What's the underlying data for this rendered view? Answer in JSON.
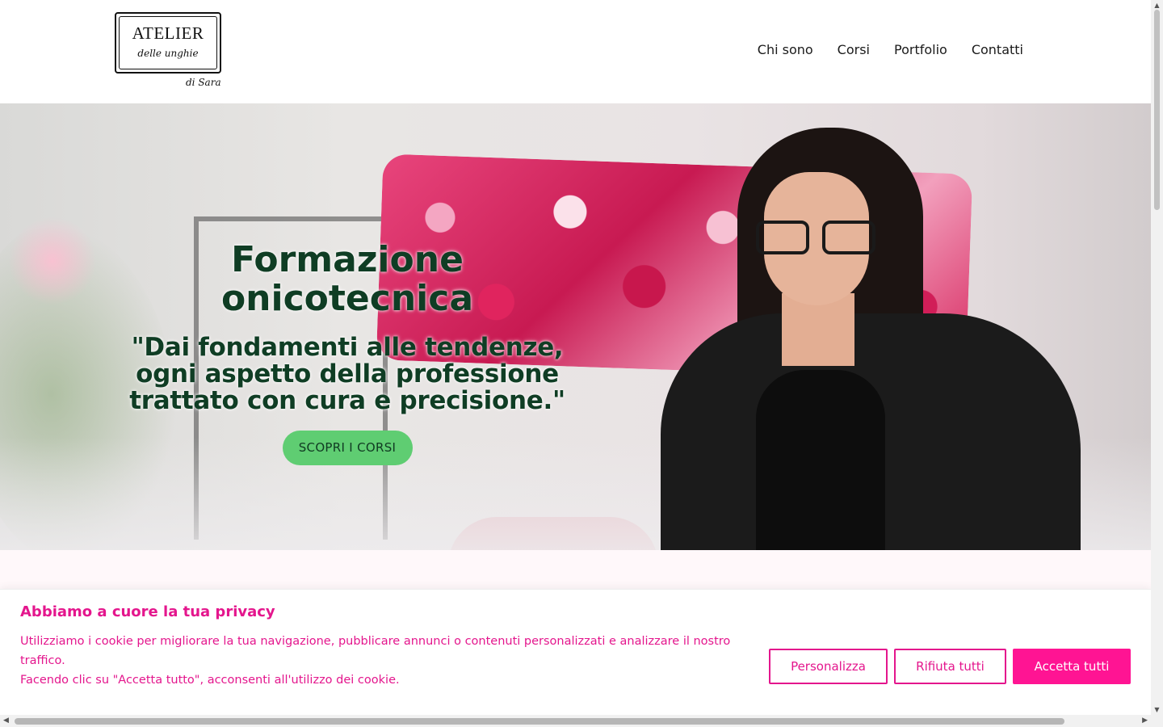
{
  "logo": {
    "title": "ATELIER",
    "subtitle": "delle unghie",
    "signature": "di Sara"
  },
  "nav": {
    "items": [
      "Chi sono",
      "Corsi",
      "Portfolio",
      "Contatti"
    ]
  },
  "hero": {
    "title_line1": "Formazione",
    "title_line2": "onicotecnica",
    "quote_line1": "\"Dai fondamenti alle tendenze,",
    "quote_line2": "ogni aspetto della professione",
    "quote_line3": "trattato con cura e precisione.\"",
    "cta_label": "SCOPRI I CORSI"
  },
  "cookie": {
    "title": "Abbiamo a cuore la tua privacy",
    "text_line1": "Utilizziamo i cookie per migliorare la tua navigazione, pubblicare annunci o contenuti personalizzati e analizzare il nostro traffico.",
    "text_line2": "Facendo clic su \"Accetta tutto\", acconsenti all'utilizzo dei cookie.",
    "customize_label": "Personalizza",
    "reject_label": "Rifiuta tutti",
    "accept_label": "Accetta tutti"
  },
  "colors": {
    "accent_pink": "#e4168d",
    "accept_button": "#ff1493",
    "hero_text_green": "#0f3d24",
    "cta_green": "#5fcd72"
  },
  "icons": {
    "scroll_up": "chevron-up-icon",
    "scroll_down": "chevron-down-icon",
    "scroll_left": "chevron-left-icon",
    "scroll_right": "chevron-right-icon"
  }
}
